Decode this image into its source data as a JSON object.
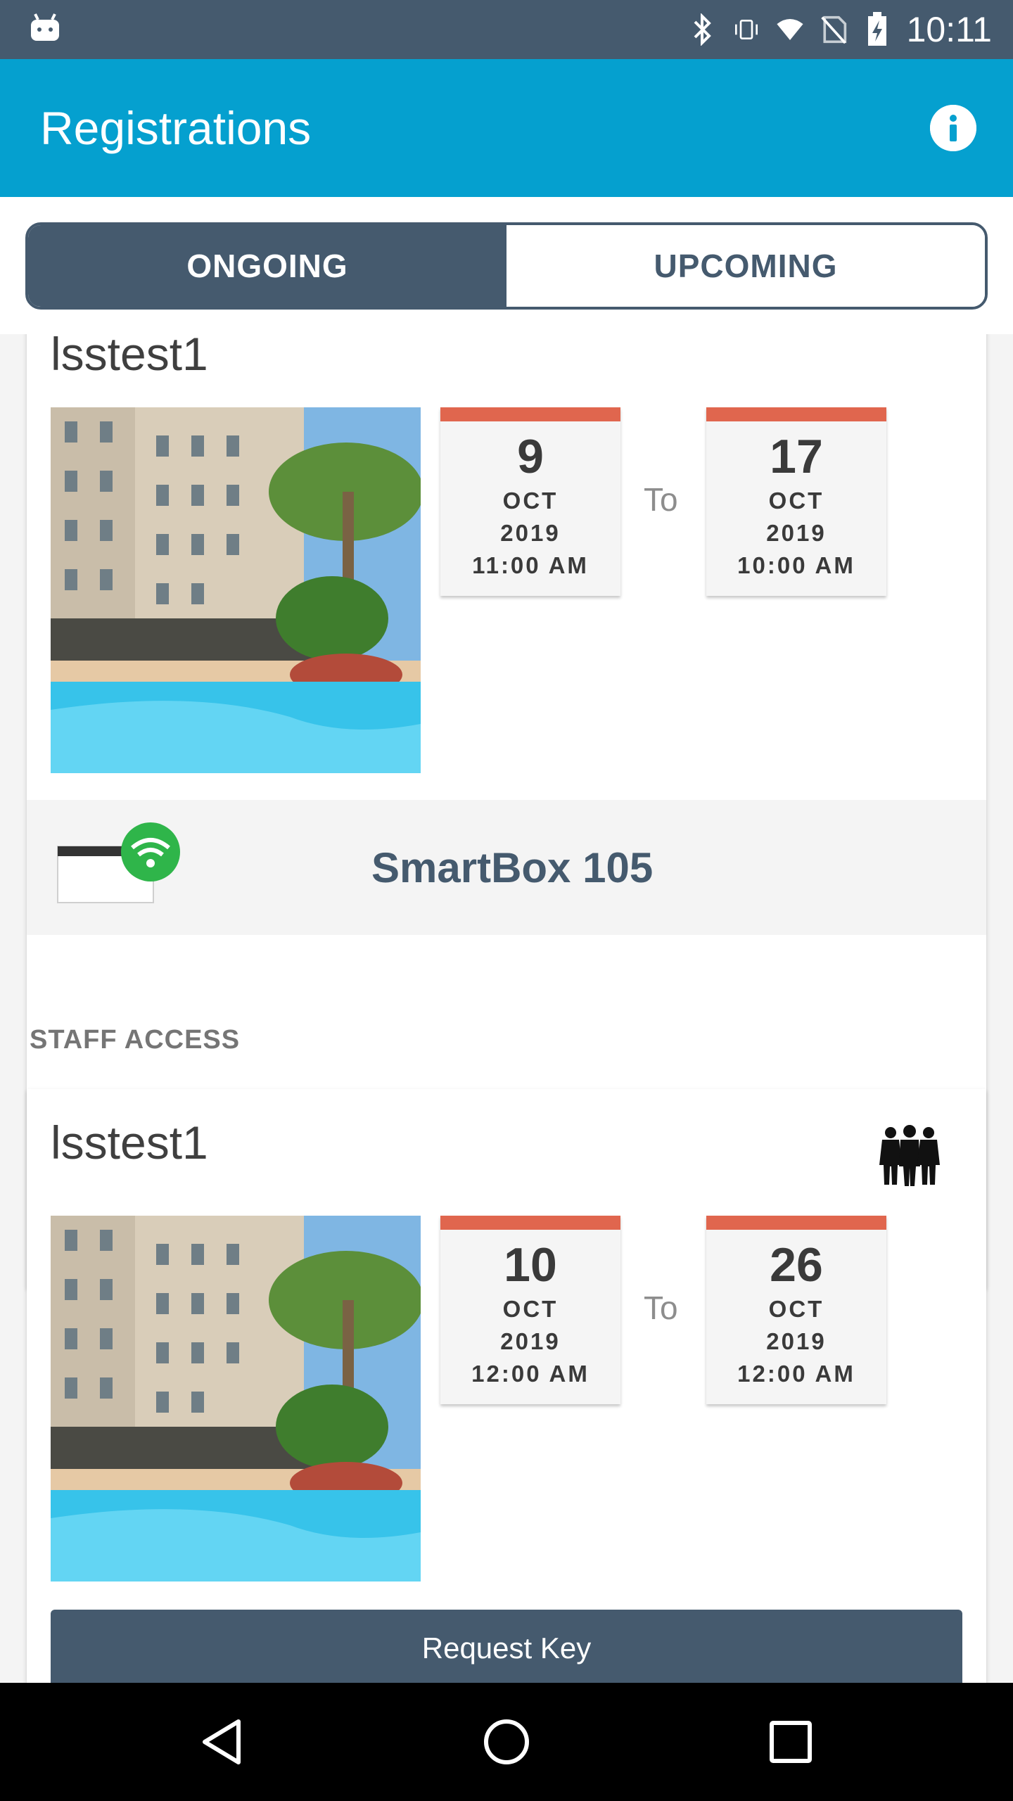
{
  "status_bar": {
    "time": "10:11",
    "icons": [
      "android-icon",
      "bluetooth-icon",
      "vibrate-icon",
      "wifi-icon",
      "no-sim-icon",
      "battery-charging-icon"
    ]
  },
  "app_bar": {
    "title": "Registrations",
    "info_icon": "info-icon"
  },
  "tabs": [
    {
      "label": "ONGOING",
      "active": true
    },
    {
      "label": "UPCOMING",
      "active": false
    }
  ],
  "registrations": [
    {
      "name": "lsstest1",
      "from": {
        "day": "9",
        "month": "OCT",
        "year": "2019",
        "time": "11:00 AM"
      },
      "to_label": "To",
      "to": {
        "day": "17",
        "month": "OCT",
        "year": "2019",
        "time": "10:00 AM"
      },
      "device": "SmartBox 105"
    }
  ],
  "staff_access": {
    "section_label": "STAFF ACCESS",
    "item": {
      "name": "lsstest1",
      "from": {
        "day": "10",
        "month": "OCT",
        "year": "2019",
        "time": "12:00 AM"
      },
      "to_label": "To",
      "to": {
        "day": "26",
        "month": "OCT",
        "year": "2019",
        "time": "12:00 AM"
      },
      "button_label": "Request Key"
    }
  },
  "colors": {
    "status_bar": "#455a6e",
    "app_bar": "#05a0cf",
    "primary_dark": "#455a6e",
    "date_accent": "#e0664e",
    "wifi_badge": "#2fb54a"
  }
}
